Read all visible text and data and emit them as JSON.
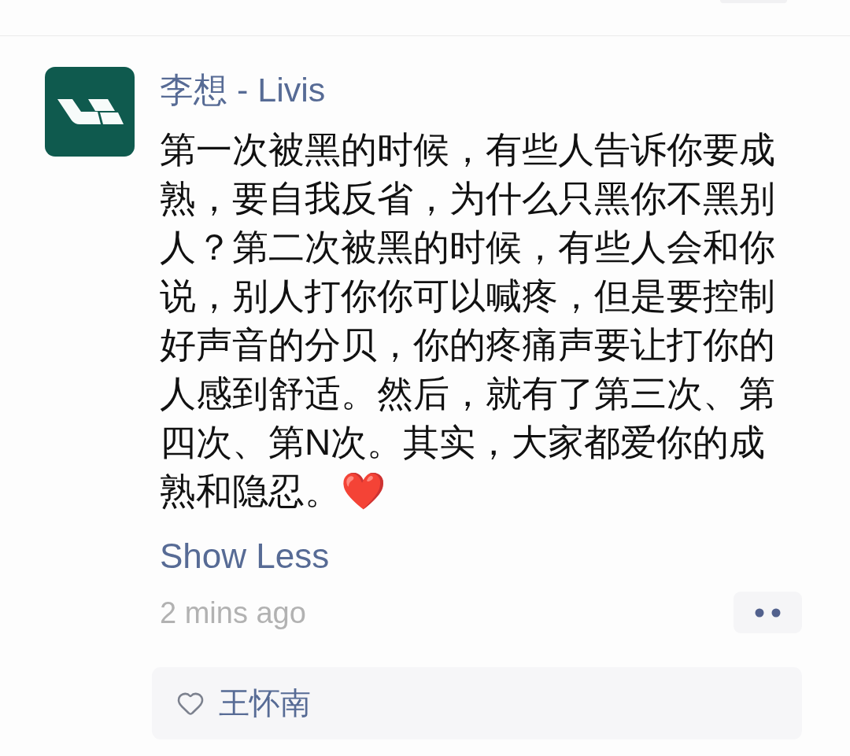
{
  "post": {
    "author": "李想 - Livis",
    "text": "第一次被黑的时候，有些人告诉你要成熟，要自我反省，为什么只黑你不黑别人？第二次被黑的时候，有些人会和你说，别人打你你可以喊疼，但是要控制好声音的分贝，你的疼痛声要让打你的人感到舒适。然后，就有了第三次、第四次、第N次。其实，大家都爱你的成熟和隐忍。❤️",
    "toggle": "Show Less",
    "time": "2 mins ago",
    "likes": [
      {
        "name": "王怀南"
      }
    ]
  }
}
